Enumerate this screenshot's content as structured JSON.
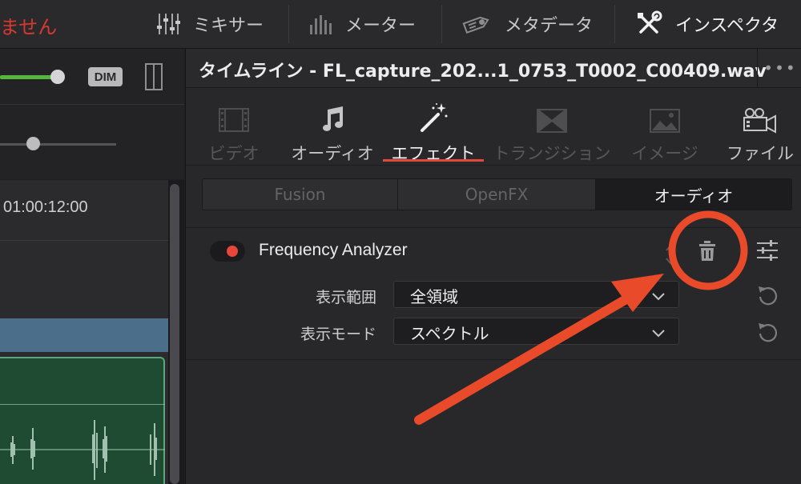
{
  "toolbar": {
    "status_text": "ません",
    "mixer_label": "ミキサー",
    "meter_label": "メーター",
    "metadata_label": "メタデータ",
    "inspector_label": "インスペクタ"
  },
  "left_panel": {
    "dim_label": "DIM",
    "timecode": "01:00:12:00"
  },
  "inspector": {
    "title": "タイムライン - FL_capture_202...1_0753_T0002_C00409.wav",
    "more": "•••",
    "tabs": [
      {
        "label": "ビデオ",
        "icon": "film-icon",
        "state": "disabled"
      },
      {
        "label": "オーディオ",
        "icon": "music-note-icon",
        "state": "enabled"
      },
      {
        "label": "エフェクト",
        "icon": "magic-wand-icon",
        "state": "selected"
      },
      {
        "label": "トランジション",
        "icon": "transition-icon",
        "state": "disabled"
      },
      {
        "label": "イメージ",
        "icon": "image-icon",
        "state": "disabled"
      },
      {
        "label": "ファイル",
        "icon": "camera-icon",
        "state": "enabled"
      }
    ],
    "subtabs": [
      "Fusion",
      "OpenFX",
      "オーディオ"
    ],
    "subtab_selected": "オーディオ",
    "effect": {
      "name": "Frequency Analyzer",
      "enabled": true,
      "params": [
        {
          "label": "表示範囲",
          "value": "全領域"
        },
        {
          "label": "表示モード",
          "value": "スペクトル"
        }
      ]
    }
  },
  "colors": {
    "accent_red": "#e0493c",
    "annotation_red": "#e84a2a",
    "volume_green": "#54b63c",
    "clip_green": "#1f4b33",
    "track_blue": "#4b6e8b"
  }
}
